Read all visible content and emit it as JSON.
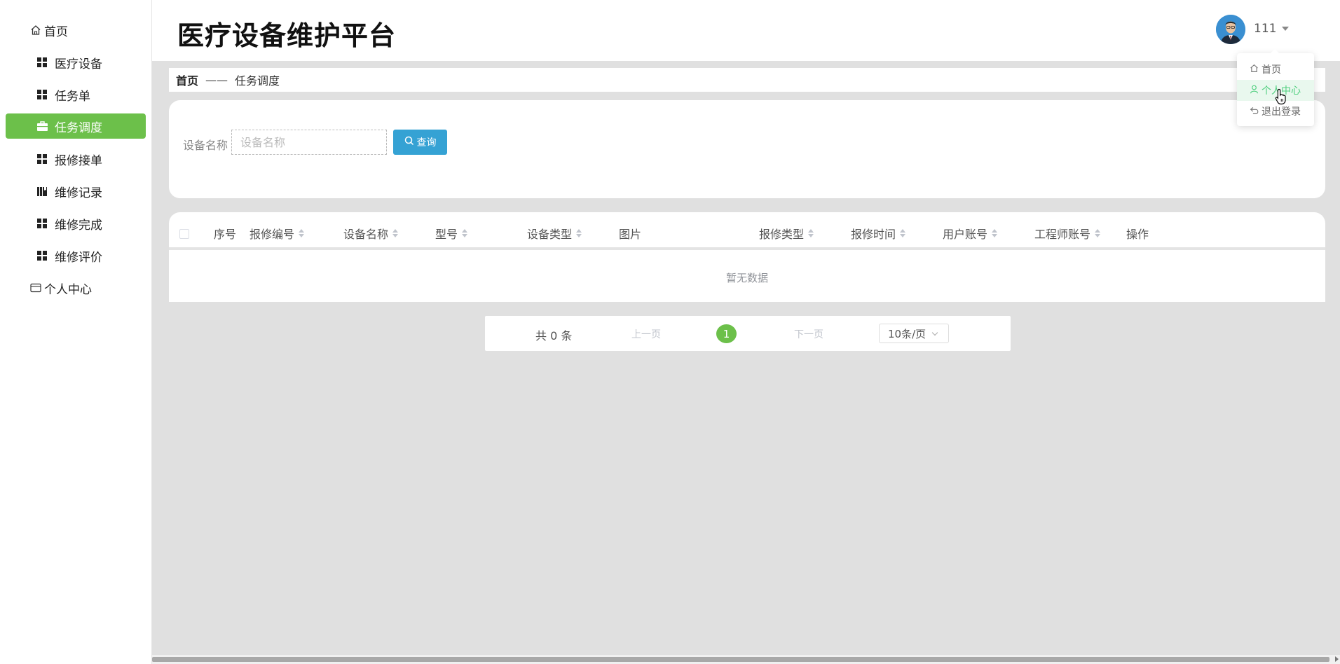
{
  "app": {
    "title": "医疗设备维护平台"
  },
  "colors": {
    "active": "#6cc04a",
    "query_button": "#35a2d4",
    "dropdown_hover": "#4fcf7e"
  },
  "sidebar": {
    "items": [
      {
        "label": "首页",
        "icon": "home-icon"
      },
      {
        "label": "医疗设备",
        "icon": "grid-icon"
      },
      {
        "label": "任务单",
        "icon": "grid-icon"
      },
      {
        "label": "任务调度",
        "icon": "briefcase-icon",
        "active": true
      },
      {
        "label": "报修接单",
        "icon": "grid-icon"
      },
      {
        "label": "维修记录",
        "icon": "book-icon"
      },
      {
        "label": "维修完成",
        "icon": "grid-icon"
      },
      {
        "label": "维修评价",
        "icon": "grid-icon"
      },
      {
        "label": "个人中心",
        "icon": "wallet-icon"
      }
    ]
  },
  "header": {
    "username": "111",
    "dropdown": [
      {
        "label": "首页",
        "icon": "home-icon"
      },
      {
        "label": "个人中心",
        "icon": "user-icon"
      },
      {
        "label": "退出登录",
        "icon": "logout-icon"
      }
    ]
  },
  "breadcrumb": {
    "home": "首页",
    "separator": "——",
    "current": "任务调度"
  },
  "search": {
    "label": "设备名称",
    "placeholder": "设备名称",
    "value": "",
    "button": "查询"
  },
  "table": {
    "columns": [
      "序号",
      "报修编号",
      "设备名称",
      "型号",
      "设备类型",
      "图片",
      "报修类型",
      "报修时间",
      "用户账号",
      "工程师账号",
      "操作"
    ],
    "empty_text": "暂无数据"
  },
  "pagination": {
    "total": "共 0 条",
    "prev": "上一页",
    "page": "1",
    "next": "下一页",
    "page_size": "10条/页"
  }
}
